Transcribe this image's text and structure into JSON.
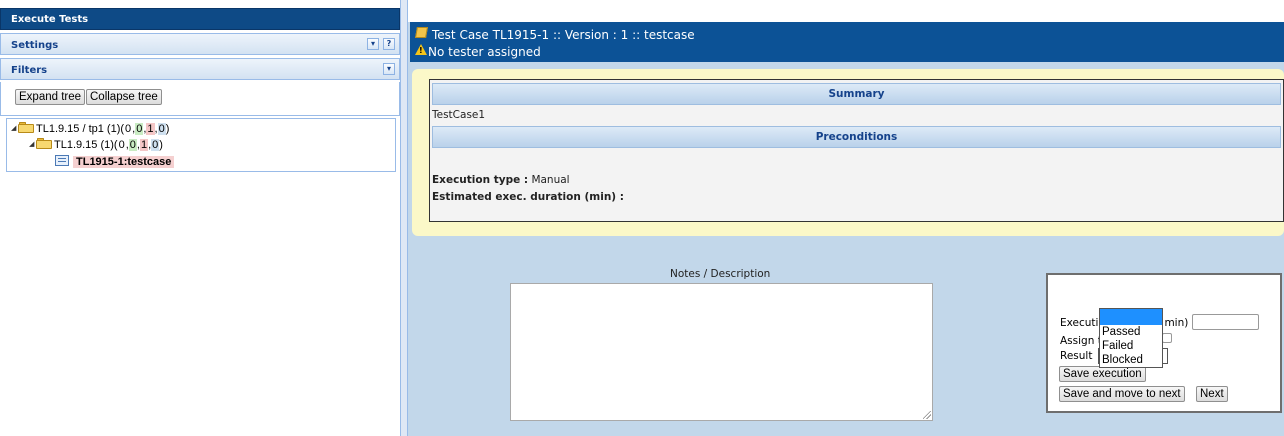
{
  "left_panel": {
    "title": "Execute Tests",
    "settings_label": "Settings",
    "settings_btn_toggle": "▾",
    "settings_btn_help": "?",
    "filters_label": "Filters",
    "filters_btn_toggle": "▾",
    "expand_tree_label": "Expand tree",
    "collapse_tree_label": "Collapse tree",
    "tree": {
      "root": {
        "label": "TL1.9.15 / tp1 (1)(",
        "c1": "0",
        "c2": "0",
        "c3": "1",
        "c4": "0",
        "close": ")"
      },
      "suite": {
        "label": "TL1.9.15 (1)(",
        "c1": "0",
        "c2": "0",
        "c3": "1",
        "c4": "0",
        "close": ")"
      },
      "testcase": {
        "label": "TL1915-1:testcase"
      }
    }
  },
  "header": {
    "title": "Test Case TL1915-1 :: Version : 1 :: testcase",
    "warning": "No tester assigned"
  },
  "summary": {
    "summary_heading": "Summary",
    "summary_text": "TestCase1",
    "preconditions_heading": "Preconditions",
    "exec_type_label": "Execution type :",
    "exec_type_value": "Manual",
    "est_duration_label": "Estimated exec. duration (min) :"
  },
  "notes": {
    "label": "Notes / Description",
    "value": ""
  },
  "execution": {
    "result_label": "Result",
    "result_selected": "",
    "result_options": [
      "",
      "Passed",
      "Failed",
      "Blocked"
    ],
    "exec_duration_label_left": "Executi",
    "exec_duration_label_right": "min)",
    "assign_label_left": "Assign t",
    "save_execution_label": "Save execution",
    "save_next_label": "Save and move to next",
    "next_label": "Next"
  },
  "colors": {
    "header_blue": "#0c5296",
    "left_title_blue": "#0e4a86",
    "summary_bg": "#fbf8c8",
    "dropdown_highlight": "#1e90ff"
  }
}
